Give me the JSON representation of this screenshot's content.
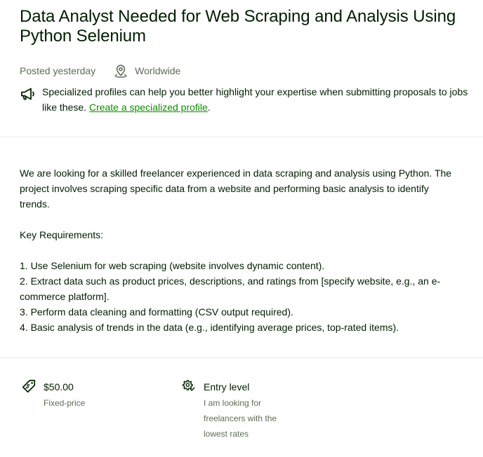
{
  "job": {
    "title": "Data Analyst Needed for Web Scraping and Analysis Using Python Selenium",
    "posted": "Posted yesterday",
    "location": "Worldwide"
  },
  "promo": {
    "text": "Specialized profiles can help you better highlight your expertise when submitting proposals to jobs like these. ",
    "link_label": "Create a specialized profile",
    "suffix": "."
  },
  "description": {
    "intro": "We are looking for a skilled freelancer experienced in data scraping and analysis using Python. The project involves scraping specific data from a website and performing basic analysis to identify trends.",
    "requirements_heading": "Key Requirements:",
    "requirements": [
      "1. Use Selenium for web scraping (website involves dynamic content).",
      "2. Extract data such as product prices, descriptions, and ratings from [specify website, e.g., an e-commerce platform].",
      "3. Perform data cleaning and formatting (CSV output required).",
      "4. Basic analysis of trends in the data (e.g., identifying average prices, top-rated items)."
    ]
  },
  "features": {
    "price": {
      "value": "$50.00",
      "label": "Fixed-price",
      "icon": "price-tag-icon"
    },
    "level": {
      "value": "Entry level",
      "label": "I am looking for freelancers with the lowest rates",
      "icon": "experience-level-icon"
    }
  },
  "colors": {
    "text": "#001e00",
    "muted": "#5e6d55",
    "link": "#108a00",
    "divider": "#e4ebe4"
  }
}
